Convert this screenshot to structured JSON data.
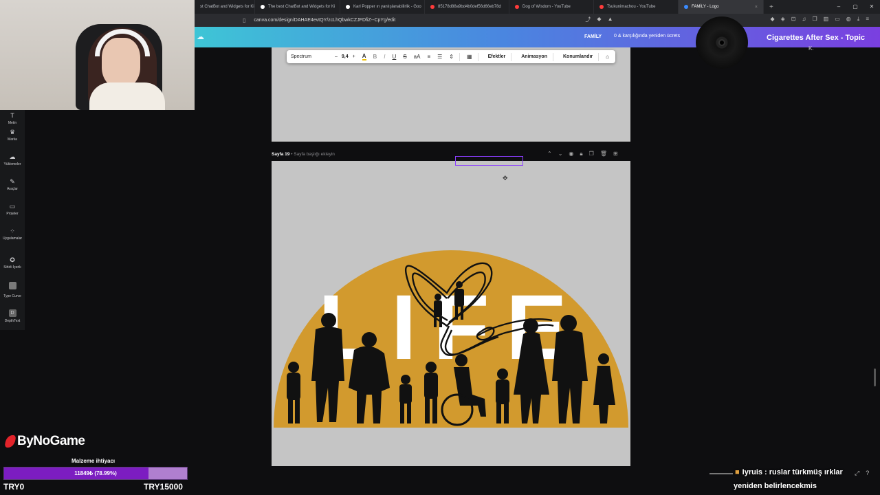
{
  "browser": {
    "tabs": [
      {
        "title": "st ChatBot and Widgets for Ki",
        "color": "#5aa0ff",
        "active": false
      },
      {
        "title": "The best ChatBot and Widgets for Ki",
        "color": "#ffffff",
        "active": false
      },
      {
        "title": "Karl Popper ın yanlışlanabilirlik - Goo",
        "color": "#ffffff",
        "active": false
      },
      {
        "title": "85178d88a9bd4b0def56d66eb78d",
        "color": "#ff3b3b",
        "active": false
      },
      {
        "title": "Dog of Wisdom - YouTube",
        "color": "#ff3b3b",
        "active": false
      },
      {
        "title": "Tsukunimachou - YouTube",
        "color": "#ff3b3b",
        "active": false
      },
      {
        "title": "FAMİLY - Logo",
        "color": "#3a8bff",
        "active": true
      }
    ],
    "close_glyph": "×",
    "new_tab_glyph": "+",
    "window_controls": [
      "–",
      "▢",
      "✕"
    ],
    "url": "canva.com/design/DAHAE4evtQY/zcLhQbwkCZJFDfiZ--CpYg/edit"
  },
  "canva_header": {
    "doc_name": "FAMİLY",
    "share_text": "0 & karşılığında yeniden ücrets"
  },
  "text_toolbar": {
    "font": "Spectrum",
    "size": "9,4",
    "minus": "–",
    "plus": "+",
    "effects_label": "Efektler",
    "animation_label": "Animasyon",
    "position_label": "Konumlandır"
  },
  "sidebar": {
    "items": [
      {
        "label": "Metin",
        "icon": "text-icon"
      },
      {
        "label": "Marka",
        "icon": "brand-icon"
      },
      {
        "label": "Yüklemeler",
        "icon": "upload-icon"
      },
      {
        "label": "Araçlar",
        "icon": "tools-icon"
      },
      {
        "label": "Projeler",
        "icon": "folder-icon"
      },
      {
        "label": "Uygulamalar",
        "icon": "apps-icon"
      },
      {
        "label": "Sihirli İçerik",
        "icon": "magic-icon"
      },
      {
        "label": "Type Curve",
        "icon": "type-curve-icon"
      },
      {
        "label": "DepthText",
        "icon": "depthtext-icon"
      }
    ]
  },
  "page19": {
    "number": "Sayfa 19",
    "placeholder": " • Sayfa başlığı ekleyin"
  },
  "artwork": {
    "word": "LIFE",
    "sun_color": "#d29a2e",
    "letter_color": "#ffffff",
    "silhouette_color": "#111111"
  },
  "music": {
    "title": "Cigarettes After Sex - Topic",
    "artist": "K."
  },
  "stream_overlay": {
    "brand": "ByNoGame",
    "goal_label": "Malzeme ihtiyacı",
    "goal_text": "11849₺ (78.99%)",
    "goal_progress": 0.7899,
    "goal_min": "TRY0",
    "goal_max": "TRY15000"
  },
  "chat": {
    "line1": "Iyruis : ruslar türkmüş ırklar",
    "line2": "yeniden belirlencekmis"
  }
}
